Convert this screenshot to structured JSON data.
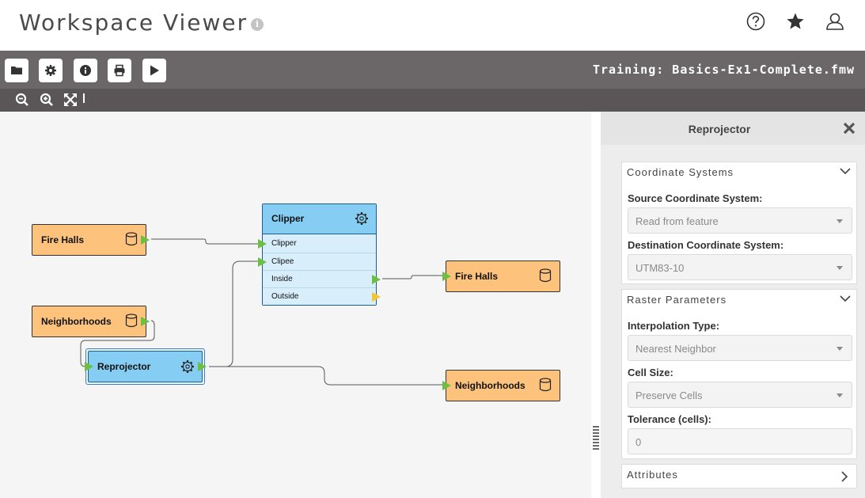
{
  "header": {
    "title": "Workspace Viewer",
    "icons": [
      "info-icon",
      "help-icon",
      "star-icon",
      "user-icon"
    ]
  },
  "toolbar": {
    "buttons": [
      "folder-icon",
      "settings-icon",
      "info-icon",
      "print-icon",
      "run-icon"
    ],
    "workspace_name": "Training: Basics-Ex1-Complete.fmw",
    "zoom_icons": [
      "zoom-out-icon",
      "zoom-in-icon",
      "fit-view-icon"
    ]
  },
  "canvas": {
    "nodes": {
      "fire_halls_in": "Fire Halls",
      "neighborhoods_in": "Neighborhoods",
      "reprojector": "Reprojector",
      "clipper": "Clipper",
      "fire_halls_out": "Fire Halls",
      "neighborhoods_out": "Neighborhoods"
    },
    "clipper_ports": {
      "clipper": "Clipper",
      "clipee": "Clipee",
      "inside": "Inside",
      "outside": "Outside"
    }
  },
  "panel": {
    "title": "Reprojector",
    "sections": {
      "coordinate_systems": {
        "title": "Coordinate Systems",
        "source_label": "Source Coordinate System:",
        "source_value": "Read from feature",
        "dest_label": "Destination Coordinate System:",
        "dest_value": "UTM83-10"
      },
      "raster_parameters": {
        "title": "Raster Parameters",
        "interp_label": "Interpolation Type:",
        "interp_value": "Nearest Neighbor",
        "cell_label": "Cell Size:",
        "cell_value": "Preserve Cells",
        "tol_label": "Tolerance (cells):",
        "tol_value": "0"
      },
      "attributes": {
        "title": "Attributes"
      }
    }
  },
  "colors": {
    "feature_node": "#fdc27c",
    "transformer_node": "#86cdf3",
    "port_green": "#6cbf41",
    "port_yellow": "#f3c634",
    "toolbar": "#6b6768"
  }
}
